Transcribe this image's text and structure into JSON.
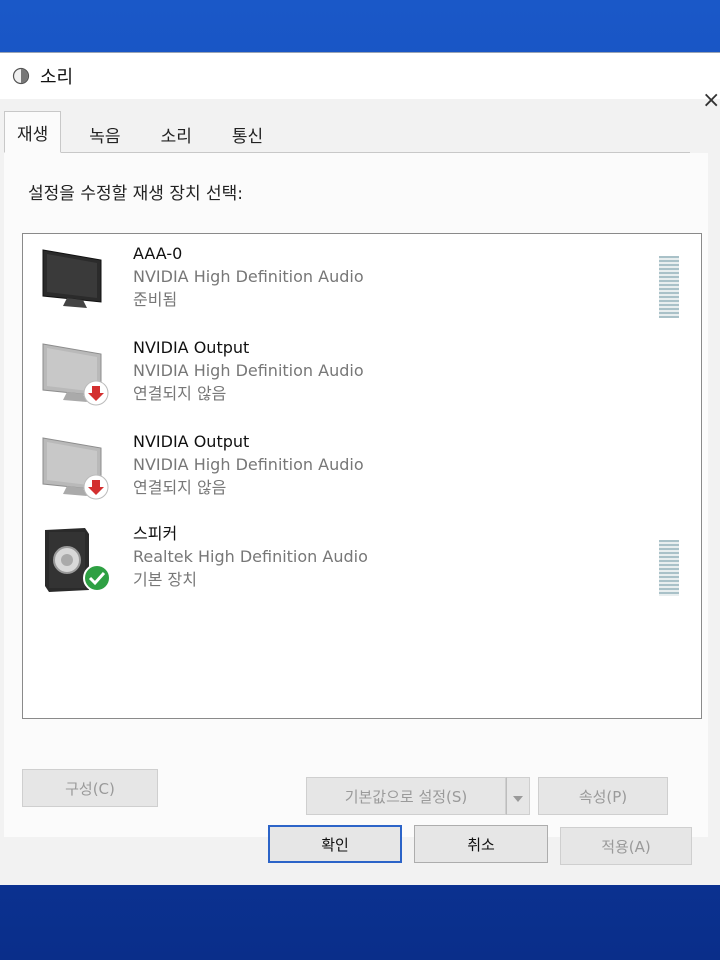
{
  "window": {
    "title": "소리",
    "close_glyph": "×"
  },
  "tabs": [
    {
      "label": "재생",
      "active": true
    },
    {
      "label": "녹음",
      "active": false
    },
    {
      "label": "소리",
      "active": false
    },
    {
      "label": "통신",
      "active": false
    }
  ],
  "instruction": "설정을 수정할 재생 장치 선택:",
  "devices": [
    {
      "name": "AAA-0",
      "driver": "NVIDIA High Definition Audio",
      "status": "준비됨",
      "icon": "monitor-icon",
      "badge": "none"
    },
    {
      "name": "NVIDIA Output",
      "driver": "NVIDIA High Definition Audio",
      "status": "연결되지 않음",
      "icon": "monitor-icon",
      "badge": "disconnected-icon"
    },
    {
      "name": "NVIDIA Output",
      "driver": "NVIDIA High Definition Audio",
      "status": "연결되지 않음",
      "icon": "monitor-icon",
      "badge": "disconnected-icon"
    },
    {
      "name": "스피커",
      "driver": "Realtek High Definition Audio",
      "status": "기본 장치",
      "icon": "speaker-icon",
      "badge": "default-check-icon"
    }
  ],
  "buttons": {
    "configure": "구성(C)",
    "set_default": "기본값으로 설정(S)",
    "properties": "속성(P)",
    "ok": "확인",
    "cancel": "취소",
    "apply": "적용(A)"
  },
  "colors": {
    "disconnected_badge": "#d32f2f",
    "default_badge": "#2ea043",
    "focus_border": "#2c64c8"
  }
}
